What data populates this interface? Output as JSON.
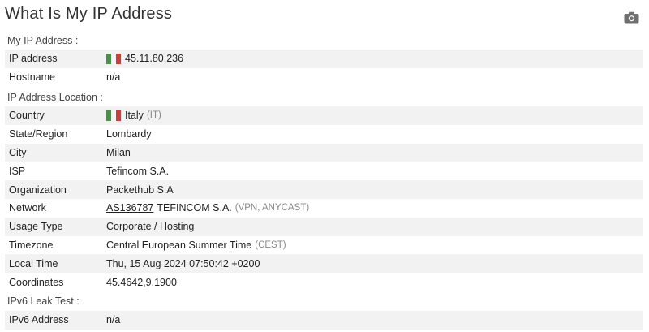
{
  "page": {
    "title": "What Is My IP Address"
  },
  "icons": {
    "camera": "camera-icon",
    "flag": "italy-flag-icon"
  },
  "colors": {
    "flag_green": "#4a8f4a",
    "flag_white": "#f4f4f4",
    "flag_red": "#c8403a",
    "row_shade": "#f2f2f2"
  },
  "ip_section": {
    "label": "My IP Address :",
    "ip_label": "IP address",
    "ip_value": "45.11.80.236",
    "hostname_label": "Hostname",
    "hostname_value": "n/a"
  },
  "location_section": {
    "label": "IP Address Location :",
    "country_label": "Country",
    "country_value": "Italy",
    "country_code": "(IT)",
    "region_label": "State/Region",
    "region_value": "Lombardy",
    "city_label": "City",
    "city_value": "Milan",
    "isp_label": "ISP",
    "isp_value": "Tefincom S.A.",
    "org_label": "Organization",
    "org_value": "Packethub S.A",
    "network_label": "Network",
    "network_asn": "AS136787",
    "network_name": "TEFINCOM S.A.",
    "network_tags": "(VPN, ANYCAST)",
    "usage_label": "Usage Type",
    "usage_value": "Corporate / Hosting",
    "timezone_label": "Timezone",
    "timezone_value": "Central European Summer Time",
    "timezone_abbr": "(CEST)",
    "localtime_label": "Local Time",
    "localtime_value": "Thu, 15 Aug 2024 07:50:42 +0200",
    "coords_label": "Coordinates",
    "coords_value": "45.4642,9.1900"
  },
  "ipv6_section": {
    "label": "IPv6 Leak Test :",
    "ipv6_label": "IPv6 Address",
    "ipv6_value": "n/a"
  }
}
